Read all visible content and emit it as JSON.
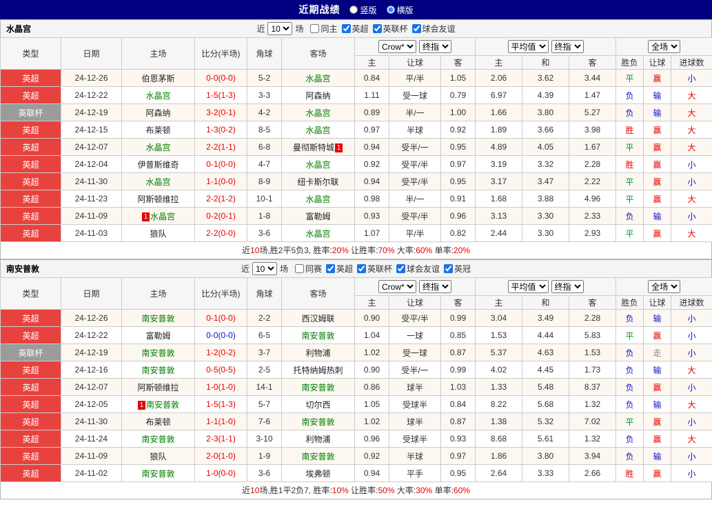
{
  "palette": {
    "topbar_bg": "#000080",
    "epl_badge": "#e8423e",
    "cup_badge": "#9b9b9b",
    "team_highlight": "#008000",
    "red": "#e60000",
    "blue": "#1111cc",
    "green": "#009933",
    "gray": "#888888",
    "odds_text": "#333333"
  },
  "topbar": {
    "title": "近期战绩",
    "radios": [
      {
        "label": "竖版",
        "checked": false
      },
      {
        "label": "横版",
        "checked": true
      }
    ]
  },
  "table_header": {
    "static": [
      "类型",
      "日期",
      "主场",
      "比分(半场)",
      "角球",
      "客场"
    ],
    "groups": [
      {
        "selects": [
          "Crow*",
          "终指"
        ],
        "subs": [
          "主",
          "让球",
          "客"
        ]
      },
      {
        "selects": [
          "平均值",
          "终指"
        ],
        "subs": [
          "主",
          "和",
          "客"
        ]
      },
      {
        "selects": [
          "全场"
        ],
        "subs": [
          "胜负",
          "让球",
          "进球数"
        ]
      }
    ]
  },
  "sections": [
    {
      "team": "水晶宫",
      "filter": {
        "near": "近",
        "count": "10",
        "games": "场",
        "checkboxes": [
          {
            "label": "同主",
            "checked": false
          },
          {
            "label": "英超",
            "checked": true
          },
          {
            "label": "英联杯",
            "checked": true
          },
          {
            "label": "球会友谊",
            "checked": true
          }
        ]
      },
      "rows": [
        {
          "league": "英超",
          "lg": "epl",
          "date": "24-12-26",
          "home": {
            "name": "伯恩茅斯"
          },
          "score": "0-0(0-0)",
          "score_c": "red",
          "corner": "5-2",
          "away": {
            "name": "水晶宫",
            "hl": true
          },
          "odds": [
            "0.84",
            "平/半",
            "1.05",
            "2.06",
            "3.62",
            "3.44"
          ],
          "results": [
            {
              "t": "平",
              "c": "green"
            },
            {
              "t": "赢",
              "c": "red"
            },
            {
              "t": "小",
              "c": "blue"
            }
          ]
        },
        {
          "league": "英超",
          "lg": "epl",
          "date": "24-12-22",
          "home": {
            "name": "水晶宫",
            "hl": true
          },
          "score": "1-5(1-3)",
          "score_c": "red",
          "corner": "3-3",
          "away": {
            "name": "阿森纳"
          },
          "odds": [
            "1.11",
            "受一球",
            "0.79",
            "6.97",
            "4.39",
            "1.47"
          ],
          "results": [
            {
              "t": "负",
              "c": "blue"
            },
            {
              "t": "输",
              "c": "blue"
            },
            {
              "t": "大",
              "c": "red"
            }
          ]
        },
        {
          "league": "英联杯",
          "lg": "cup",
          "date": "24-12-19",
          "home": {
            "name": "阿森纳"
          },
          "score": "3-2(0-1)",
          "score_c": "red",
          "corner": "4-2",
          "away": {
            "name": "水晶宫",
            "hl": true
          },
          "odds": [
            "0.89",
            "半/一",
            "1.00",
            "1.66",
            "3.80",
            "5.27"
          ],
          "results": [
            {
              "t": "负",
              "c": "blue"
            },
            {
              "t": "输",
              "c": "blue"
            },
            {
              "t": "大",
              "c": "red"
            }
          ]
        },
        {
          "league": "英超",
          "lg": "epl",
          "date": "24-12-15",
          "home": {
            "name": "布莱顿"
          },
          "score": "1-3(0-2)",
          "score_c": "red",
          "corner": "8-5",
          "away": {
            "name": "水晶宫",
            "hl": true
          },
          "odds": [
            "0.97",
            "半球",
            "0.92",
            "1.89",
            "3.66",
            "3.98"
          ],
          "results": [
            {
              "t": "胜",
              "c": "red"
            },
            {
              "t": "赢",
              "c": "red"
            },
            {
              "t": "大",
              "c": "red"
            }
          ]
        },
        {
          "league": "英超",
          "lg": "epl",
          "date": "24-12-07",
          "home": {
            "name": "水晶宫",
            "hl": true
          },
          "score": "2-2(1-1)",
          "score_c": "red",
          "corner": "6-8",
          "away": {
            "name": "曼彻斯特城",
            "badge_post": "1"
          },
          "odds": [
            "0.94",
            "受半/一",
            "0.95",
            "4.89",
            "4.05",
            "1.67"
          ],
          "results": [
            {
              "t": "平",
              "c": "green"
            },
            {
              "t": "赢",
              "c": "red"
            },
            {
              "t": "大",
              "c": "red"
            }
          ]
        },
        {
          "league": "英超",
          "lg": "epl",
          "date": "24-12-04",
          "home": {
            "name": "伊普斯维奇"
          },
          "score": "0-1(0-0)",
          "score_c": "red",
          "corner": "4-7",
          "away": {
            "name": "水晶宫",
            "hl": true
          },
          "odds": [
            "0.92",
            "受平/半",
            "0.97",
            "3.19",
            "3.32",
            "2.28"
          ],
          "results": [
            {
              "t": "胜",
              "c": "red"
            },
            {
              "t": "赢",
              "c": "red"
            },
            {
              "t": "小",
              "c": "blue"
            }
          ]
        },
        {
          "league": "英超",
          "lg": "epl",
          "date": "24-11-30",
          "home": {
            "name": "水晶宫",
            "hl": true
          },
          "score": "1-1(0-0)",
          "score_c": "red",
          "corner": "8-9",
          "away": {
            "name": "纽卡斯尔联"
          },
          "odds": [
            "0.94",
            "受平/半",
            "0.95",
            "3.17",
            "3.47",
            "2.22"
          ],
          "results": [
            {
              "t": "平",
              "c": "green"
            },
            {
              "t": "赢",
              "c": "red"
            },
            {
              "t": "小",
              "c": "blue"
            }
          ]
        },
        {
          "league": "英超",
          "lg": "epl",
          "date": "24-11-23",
          "home": {
            "name": "阿斯顿维拉"
          },
          "score": "2-2(1-2)",
          "score_c": "red",
          "corner": "10-1",
          "away": {
            "name": "水晶宫",
            "hl": true
          },
          "odds": [
            "0.98",
            "半/一",
            "0.91",
            "1.68",
            "3.88",
            "4.96"
          ],
          "results": [
            {
              "t": "平",
              "c": "green"
            },
            {
              "t": "赢",
              "c": "red"
            },
            {
              "t": "大",
              "c": "red"
            }
          ]
        },
        {
          "league": "英超",
          "lg": "epl",
          "date": "24-11-09",
          "home": {
            "name": "水晶宫",
            "hl": true,
            "badge_pre": "1"
          },
          "score": "0-2(0-1)",
          "score_c": "red",
          "corner": "1-8",
          "away": {
            "name": "富勒姆"
          },
          "odds": [
            "0.93",
            "受平/半",
            "0.96",
            "3.13",
            "3.30",
            "2.33"
          ],
          "results": [
            {
              "t": "负",
              "c": "blue"
            },
            {
              "t": "输",
              "c": "blue"
            },
            {
              "t": "小",
              "c": "blue"
            }
          ]
        },
        {
          "league": "英超",
          "lg": "epl",
          "date": "24-11-03",
          "home": {
            "name": "狼队"
          },
          "score": "2-2(0-0)",
          "score_c": "red",
          "corner": "3-6",
          "away": {
            "name": "水晶宫",
            "hl": true
          },
          "odds": [
            "1.07",
            "平/半",
            "0.82",
            "2.44",
            "3.30",
            "2.93"
          ],
          "results": [
            {
              "t": "平",
              "c": "green"
            },
            {
              "t": "赢",
              "c": "red"
            },
            {
              "t": "大",
              "c": "red"
            }
          ]
        }
      ],
      "summary": [
        {
          "t": "近",
          "c": "dark"
        },
        {
          "t": "10",
          "c": "red"
        },
        {
          "t": "场,胜2平5负3, 胜率:",
          "c": "dark"
        },
        {
          "t": "20%",
          "c": "red"
        },
        {
          "t": " 让胜率:",
          "c": "dark"
        },
        {
          "t": "70%",
          "c": "red"
        },
        {
          "t": " 大率:",
          "c": "dark"
        },
        {
          "t": "60%",
          "c": "red"
        },
        {
          "t": " 单率:",
          "c": "dark"
        },
        {
          "t": "20%",
          "c": "red"
        }
      ]
    },
    {
      "team": "南安普敦",
      "filter": {
        "near": "近",
        "count": "10",
        "games": "场",
        "checkboxes": [
          {
            "label": "同赛",
            "checked": false
          },
          {
            "label": "英超",
            "checked": true
          },
          {
            "label": "英联杯",
            "checked": true
          },
          {
            "label": "球会友谊",
            "checked": true
          },
          {
            "label": "英冠",
            "checked": true
          }
        ]
      },
      "rows": [
        {
          "league": "英超",
          "lg": "epl",
          "date": "24-12-26",
          "home": {
            "name": "南安普敦",
            "hl": true
          },
          "score": "0-1(0-0)",
          "score_c": "red",
          "corner": "2-2",
          "away": {
            "name": "西汉姆联"
          },
          "odds": [
            "0.90",
            "受平/半",
            "0.99",
            "3.04",
            "3.49",
            "2.28"
          ],
          "results": [
            {
              "t": "负",
              "c": "blue"
            },
            {
              "t": "输",
              "c": "blue"
            },
            {
              "t": "小",
              "c": "blue"
            }
          ]
        },
        {
          "league": "英超",
          "lg": "epl",
          "date": "24-12-22",
          "home": {
            "name": "富勒姆"
          },
          "score": "0-0(0-0)",
          "score_c": "blue",
          "corner": "6-5",
          "away": {
            "name": "南安普敦",
            "hl": true
          },
          "odds": [
            "1.04",
            "一球",
            "0.85",
            "1.53",
            "4.44",
            "5.83"
          ],
          "results": [
            {
              "t": "平",
              "c": "green"
            },
            {
              "t": "赢",
              "c": "red"
            },
            {
              "t": "小",
              "c": "blue"
            }
          ]
        },
        {
          "league": "英联杯",
          "lg": "cup",
          "date": "24-12-19",
          "home": {
            "name": "南安普敦",
            "hl": true
          },
          "score": "1-2(0-2)",
          "score_c": "red",
          "corner": "3-7",
          "away": {
            "name": "利物浦"
          },
          "odds": [
            "1.02",
            "受一球",
            "0.87",
            "5.37",
            "4.63",
            "1.53"
          ],
          "results": [
            {
              "t": "负",
              "c": "blue"
            },
            {
              "t": "走",
              "c": "gray"
            },
            {
              "t": "小",
              "c": "blue"
            }
          ]
        },
        {
          "league": "英超",
          "lg": "epl",
          "date": "24-12-16",
          "home": {
            "name": "南安普敦",
            "hl": true
          },
          "score": "0-5(0-5)",
          "score_c": "red",
          "corner": "2-5",
          "away": {
            "name": "托特纳姆热刺"
          },
          "odds": [
            "0.90",
            "受半/一",
            "0.99",
            "4.02",
            "4.45",
            "1.73"
          ],
          "results": [
            {
              "t": "负",
              "c": "blue"
            },
            {
              "t": "输",
              "c": "blue"
            },
            {
              "t": "大",
              "c": "red"
            }
          ]
        },
        {
          "league": "英超",
          "lg": "epl",
          "date": "24-12-07",
          "home": {
            "name": "阿斯顿维拉"
          },
          "score": "1-0(1-0)",
          "score_c": "red",
          "corner": "14-1",
          "away": {
            "name": "南安普敦",
            "hl": true
          },
          "odds": [
            "0.86",
            "球半",
            "1.03",
            "1.33",
            "5.48",
            "8.37"
          ],
          "results": [
            {
              "t": "负",
              "c": "blue"
            },
            {
              "t": "赢",
              "c": "red"
            },
            {
              "t": "小",
              "c": "blue"
            }
          ]
        },
        {
          "league": "英超",
          "lg": "epl",
          "date": "24-12-05",
          "home": {
            "name": "南安普敦",
            "hl": true,
            "badge_pre": "1"
          },
          "score": "1-5(1-3)",
          "score_c": "red",
          "corner": "5-7",
          "away": {
            "name": "切尔西"
          },
          "odds": [
            "1.05",
            "受球半",
            "0.84",
            "8.22",
            "5.68",
            "1.32"
          ],
          "results": [
            {
              "t": "负",
              "c": "blue"
            },
            {
              "t": "输",
              "c": "blue"
            },
            {
              "t": "大",
              "c": "red"
            }
          ]
        },
        {
          "league": "英超",
          "lg": "epl",
          "date": "24-11-30",
          "home": {
            "name": "布莱顿"
          },
          "score": "1-1(1-0)",
          "score_c": "red",
          "corner": "7-6",
          "away": {
            "name": "南安普敦",
            "hl": true
          },
          "odds": [
            "1.02",
            "球半",
            "0.87",
            "1.38",
            "5.32",
            "7.02"
          ],
          "results": [
            {
              "t": "平",
              "c": "green"
            },
            {
              "t": "赢",
              "c": "red"
            },
            {
              "t": "小",
              "c": "blue"
            }
          ]
        },
        {
          "league": "英超",
          "lg": "epl",
          "date": "24-11-24",
          "home": {
            "name": "南安普敦",
            "hl": true
          },
          "score": "2-3(1-1)",
          "score_c": "red",
          "corner": "3-10",
          "away": {
            "name": "利物浦"
          },
          "odds": [
            "0.96",
            "受球半",
            "0.93",
            "8.68",
            "5.61",
            "1.32"
          ],
          "results": [
            {
              "t": "负",
              "c": "blue"
            },
            {
              "t": "赢",
              "c": "red"
            },
            {
              "t": "大",
              "c": "red"
            }
          ]
        },
        {
          "league": "英超",
          "lg": "epl",
          "date": "24-11-09",
          "home": {
            "name": "狼队"
          },
          "score": "2-0(1-0)",
          "score_c": "red",
          "corner": "1-9",
          "away": {
            "name": "南安普敦",
            "hl": true
          },
          "odds": [
            "0.92",
            "半球",
            "0.97",
            "1.86",
            "3.80",
            "3.94"
          ],
          "results": [
            {
              "t": "负",
              "c": "blue"
            },
            {
              "t": "输",
              "c": "blue"
            },
            {
              "t": "小",
              "c": "blue"
            }
          ]
        },
        {
          "league": "英超",
          "lg": "epl",
          "date": "24-11-02",
          "home": {
            "name": "南安普敦",
            "hl": true
          },
          "score": "1-0(0-0)",
          "score_c": "red",
          "corner": "3-6",
          "away": {
            "name": "埃弗顿"
          },
          "odds": [
            "0.94",
            "平手",
            "0.95",
            "2.64",
            "3.33",
            "2.66"
          ],
          "results": [
            {
              "t": "胜",
              "c": "red"
            },
            {
              "t": "赢",
              "c": "red"
            },
            {
              "t": "小",
              "c": "blue"
            }
          ]
        }
      ],
      "summary": [
        {
          "t": "近",
          "c": "dark"
        },
        {
          "t": "10",
          "c": "red"
        },
        {
          "t": "场,胜1平2负7, 胜率:",
          "c": "dark"
        },
        {
          "t": "10%",
          "c": "red"
        },
        {
          "t": " 让胜率:",
          "c": "dark"
        },
        {
          "t": "50%",
          "c": "red"
        },
        {
          "t": " 大率:",
          "c": "dark"
        },
        {
          "t": "30%",
          "c": "red"
        },
        {
          "t": " 单率:",
          "c": "dark"
        },
        {
          "t": "60%",
          "c": "red"
        }
      ]
    }
  ]
}
